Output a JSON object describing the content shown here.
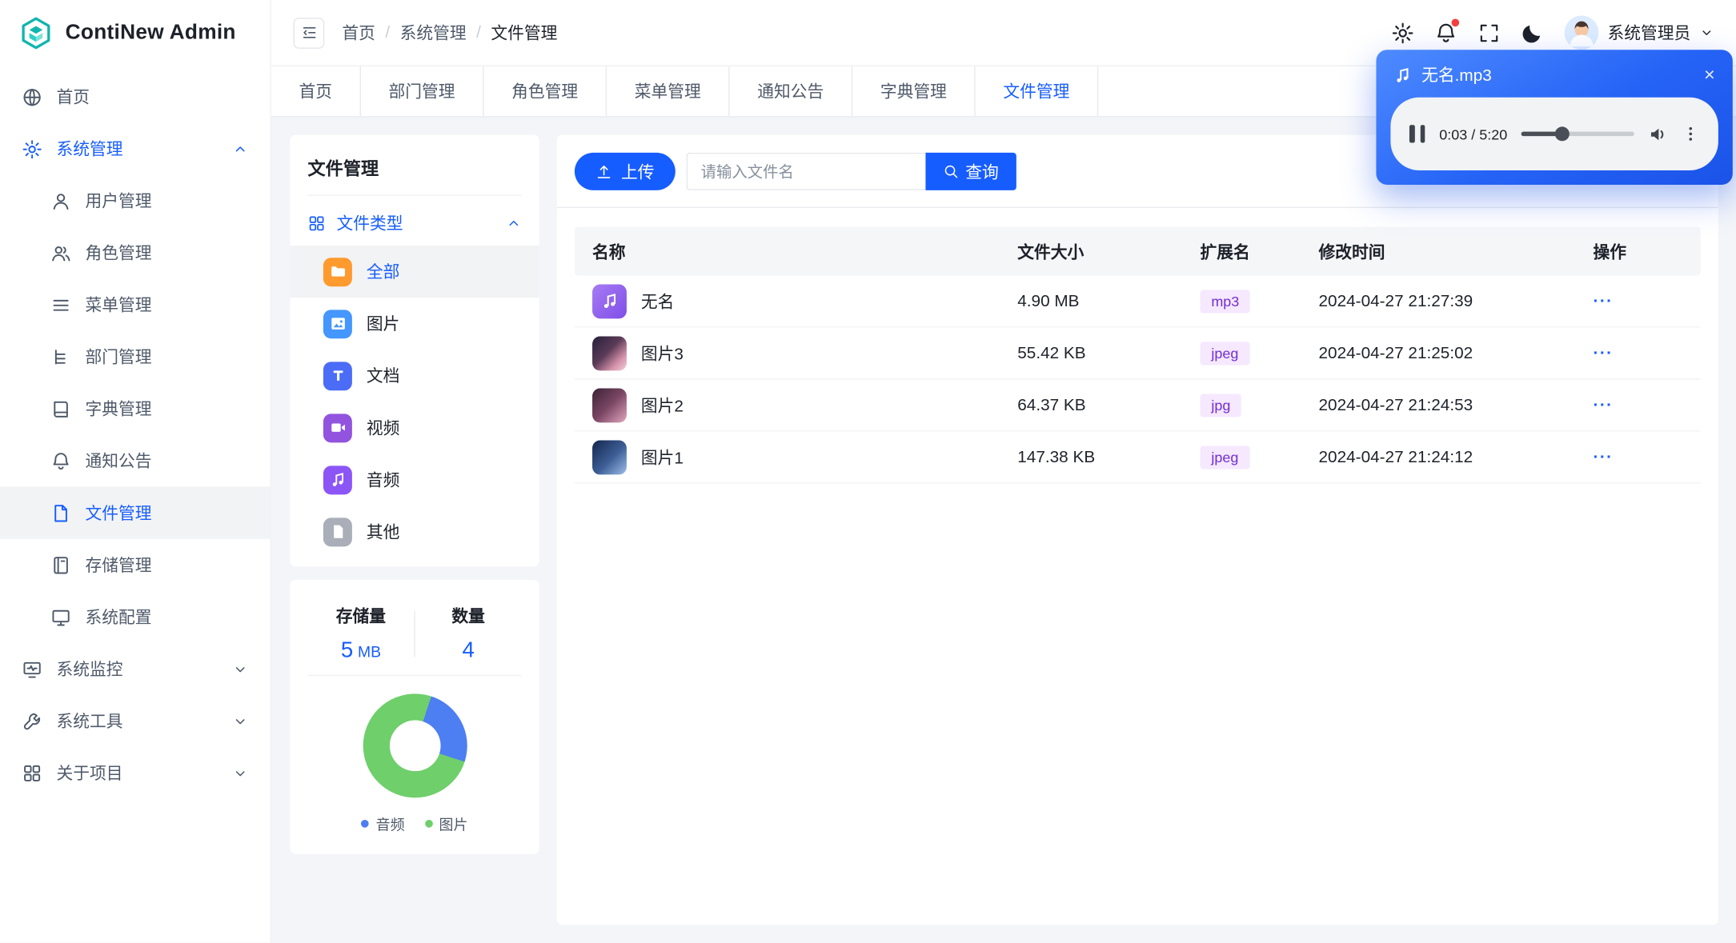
{
  "app": {
    "name": "ContiNew Admin"
  },
  "header": {
    "breadcrumb": [
      "首页",
      "系统管理",
      "文件管理"
    ],
    "separator": "/",
    "user_name": "系统管理员"
  },
  "tabs": {
    "items": [
      "首页",
      "部门管理",
      "角色管理",
      "菜单管理",
      "通知公告",
      "字典管理",
      "文件管理"
    ],
    "active": "文件管理"
  },
  "sidebar": {
    "items": [
      {
        "label": "首页"
      },
      {
        "label": "系统管理"
      },
      {
        "label": "系统监控"
      },
      {
        "label": "系统工具"
      },
      {
        "label": "关于项目"
      }
    ],
    "system_children": [
      {
        "label": "用户管理"
      },
      {
        "label": "角色管理"
      },
      {
        "label": "菜单管理"
      },
      {
        "label": "部门管理"
      },
      {
        "label": "字典管理"
      },
      {
        "label": "通知公告"
      },
      {
        "label": "文件管理"
      },
      {
        "label": "存储管理"
      },
      {
        "label": "系统配置"
      }
    ],
    "expanded_item": "系统管理",
    "active_item": "文件管理"
  },
  "file_panel": {
    "title": "文件管理",
    "group_label": "文件类型",
    "types": [
      {
        "label": "全部",
        "color": "#FF9A2E"
      },
      {
        "label": "图片",
        "color": "#4596FF"
      },
      {
        "label": "文档",
        "color": "#4A6CF7"
      },
      {
        "label": "视频",
        "color": "#9254DE"
      },
      {
        "label": "音频",
        "color": "#8C55F6"
      },
      {
        "label": "其他",
        "color": "#A9AEB8"
      }
    ],
    "active_type": "全部",
    "stats": {
      "storage_label": "存储量",
      "storage_value": "5",
      "storage_unit": "MB",
      "count_label": "数量",
      "count_value": "4"
    }
  },
  "chart_data": {
    "type": "pie",
    "labels": [
      "音频",
      "图片"
    ],
    "values": [
      1,
      3
    ],
    "colors": [
      "#4D7EF2",
      "#6FCF6B"
    ],
    "legend_position": "bottom"
  },
  "toolbar": {
    "upload_label": "上传",
    "search_placeholder": "请输入文件名",
    "query_label": "查询"
  },
  "table": {
    "headers": [
      "名称",
      "文件大小",
      "扩展名",
      "修改时间",
      "操作"
    ],
    "rows": [
      {
        "name": "无名",
        "size": "4.90 MB",
        "ext": "mp3",
        "modified": "2024-04-27 21:27:39",
        "kind": "audio"
      },
      {
        "name": "图片3",
        "size": "55.42 KB",
        "ext": "jpeg",
        "modified": "2024-04-27 21:25:02",
        "kind": "image"
      },
      {
        "name": "图片2",
        "size": "64.37 KB",
        "ext": "jpg",
        "modified": "2024-04-27 21:24:53",
        "kind": "image"
      },
      {
        "name": "图片1",
        "size": "147.38 KB",
        "ext": "jpeg",
        "modified": "2024-04-27 21:24:12",
        "kind": "image"
      }
    ],
    "action_glyph": "···"
  },
  "player": {
    "title": "无名.mp3",
    "time": "0:03 / 5:20",
    "close_glyph": "×"
  },
  "colors": {
    "primary": "#165DFF",
    "tag_bg": "#F5E8FF",
    "tag_text": "#722ED1",
    "page_bg": "#F3F5F9"
  }
}
